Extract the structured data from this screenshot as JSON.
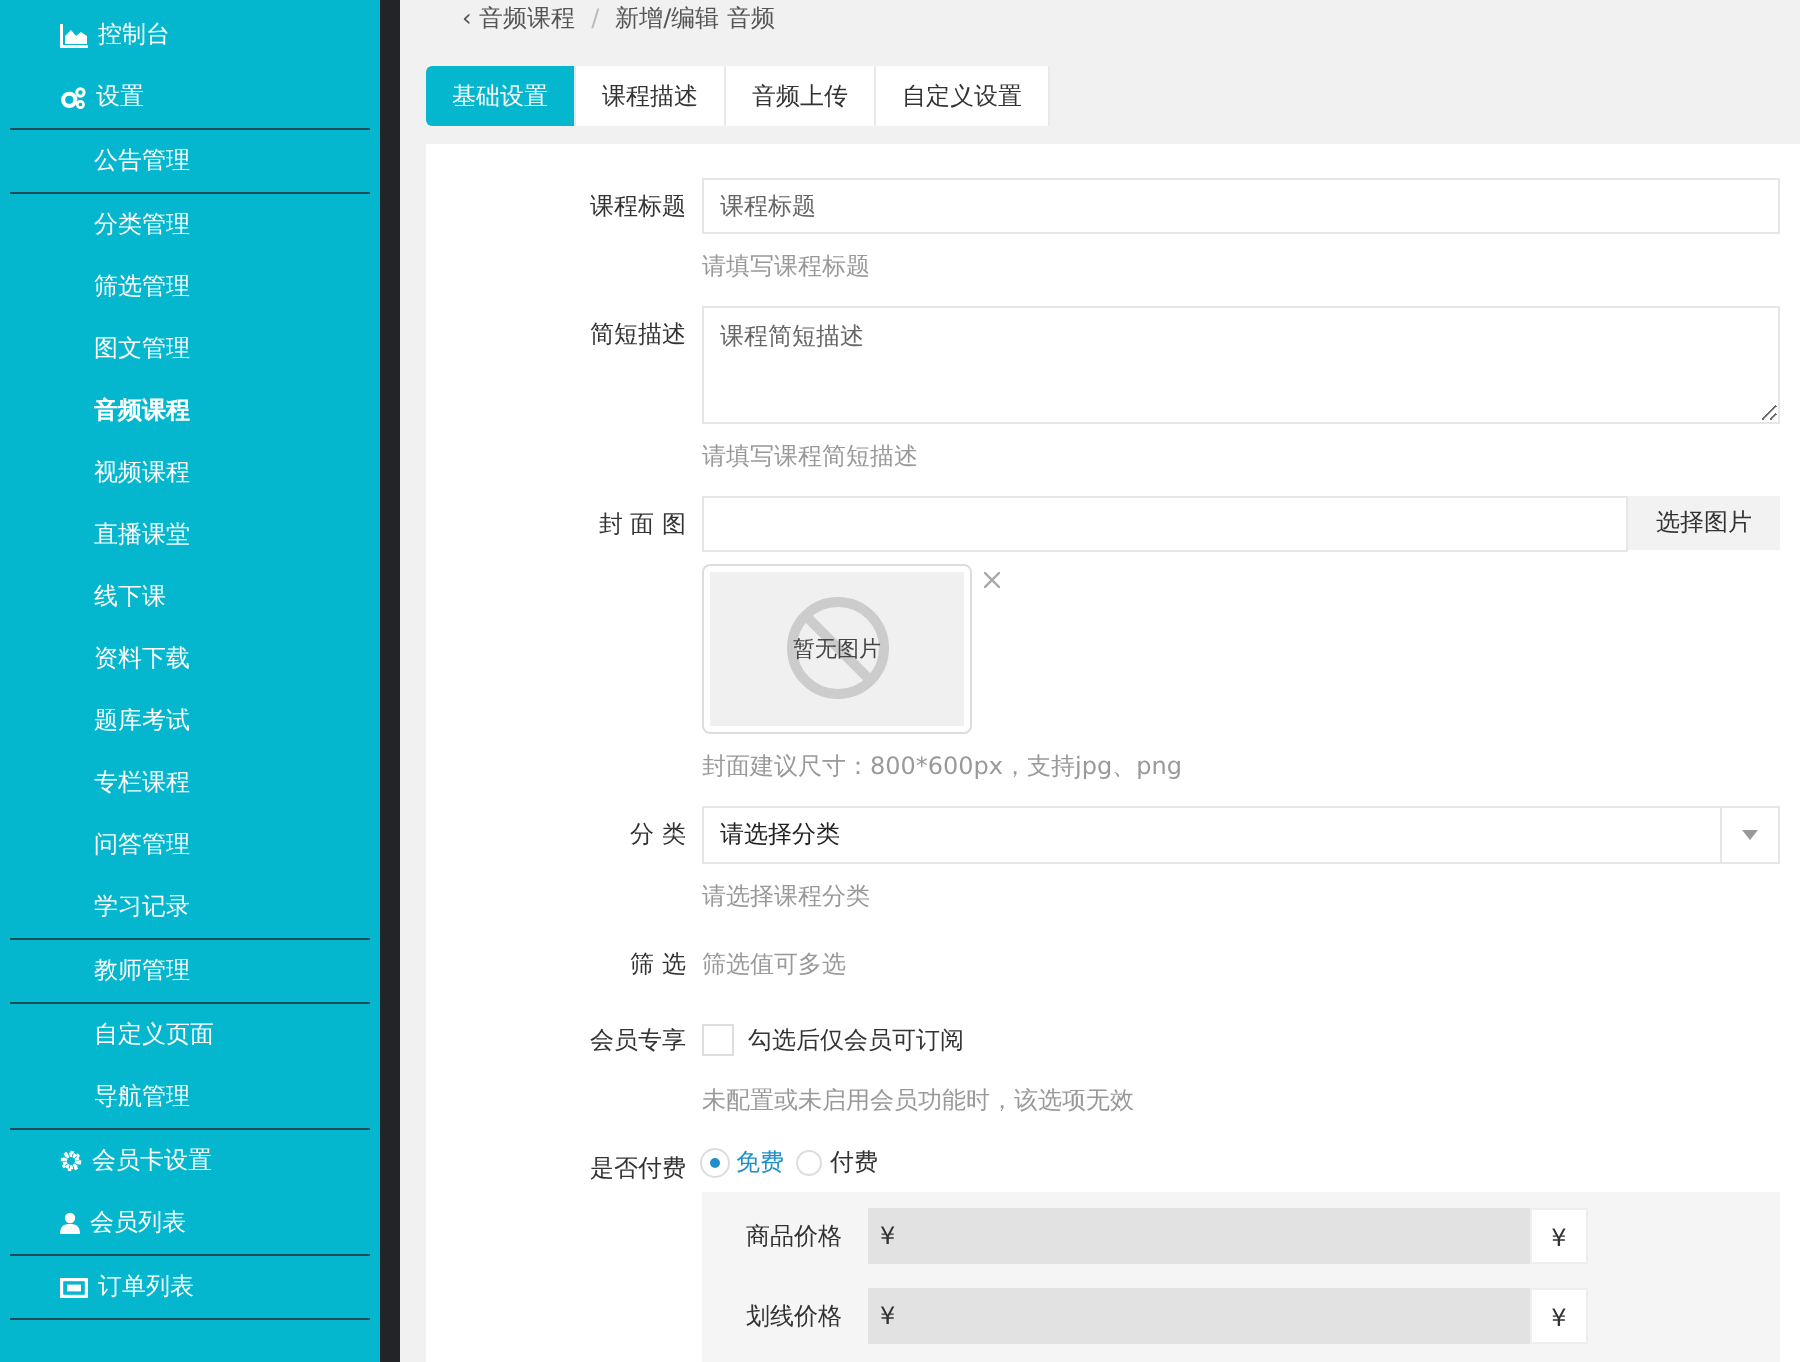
{
  "breadcrumb": {
    "back_icon": "‹",
    "back": "音频课程",
    "separator": "/",
    "current": "新增/编辑 音频"
  },
  "sidebar": {
    "groups": [
      {
        "items": [
          {
            "label": "控制台",
            "kind": "chart",
            "selected": false
          },
          {
            "label": "设置",
            "kind": "gears",
            "selected": false
          }
        ]
      },
      {
        "items": [
          {
            "label": "公告管理",
            "kind": "sub",
            "selected": false
          }
        ]
      },
      {
        "items": [
          {
            "label": "分类管理",
            "kind": "sub",
            "selected": false
          },
          {
            "label": "筛选管理",
            "kind": "sub",
            "selected": false
          },
          {
            "label": "图文管理",
            "kind": "sub",
            "selected": false
          },
          {
            "label": "音频课程",
            "kind": "sub",
            "selected": true
          },
          {
            "label": "视频课程",
            "kind": "sub",
            "selected": false
          },
          {
            "label": "直播课堂",
            "kind": "sub",
            "selected": false
          },
          {
            "label": "线下课",
            "kind": "sub",
            "selected": false
          },
          {
            "label": "资料下载",
            "kind": "sub",
            "selected": false
          },
          {
            "label": "题库考试",
            "kind": "sub",
            "selected": false
          },
          {
            "label": "专栏课程",
            "kind": "sub",
            "selected": false
          },
          {
            "label": "问答管理",
            "kind": "sub",
            "selected": false
          },
          {
            "label": "学习记录",
            "kind": "sub",
            "selected": false
          }
        ]
      },
      {
        "items": [
          {
            "label": "教师管理",
            "kind": "sub",
            "selected": false
          }
        ]
      },
      {
        "items": [
          {
            "label": "自定义页面",
            "kind": "sub",
            "selected": false
          },
          {
            "label": "导航管理",
            "kind": "sub",
            "selected": false
          }
        ]
      },
      {
        "items": [
          {
            "label": "会员卡设置",
            "kind": "gear",
            "selected": false
          },
          {
            "label": "会员列表",
            "kind": "user",
            "selected": false
          }
        ]
      },
      {
        "items": [
          {
            "label": "订单列表",
            "kind": "card",
            "selected": false
          }
        ]
      }
    ]
  },
  "tabs": [
    {
      "label": "基础设置",
      "selected": true
    },
    {
      "label": "课程描述",
      "selected": false
    },
    {
      "label": "音频上传",
      "selected": false
    },
    {
      "label": "自定义设置",
      "selected": false
    }
  ],
  "form": {
    "title": {
      "label": "课程标题",
      "placeholder": "课程标题",
      "hint": "请填写课程标题"
    },
    "summary": {
      "label": "简短描述",
      "placeholder": "课程简短描述",
      "hint": "请填写课程简短描述"
    },
    "cover": {
      "label": "封 面 图",
      "button": "选择图片",
      "image_text": "暂无图片",
      "hint": "封面建议尺寸：800*600px，支持jpg、png"
    },
    "category": {
      "label": "分 类",
      "value": "请选择分类",
      "hint": "请选择课程分类"
    },
    "filter": {
      "label": "筛 选",
      "hint": "筛选值可多选"
    },
    "members_only": {
      "label": "会员专享",
      "checked": false,
      "text": "勾选后仅会员可订阅",
      "hint": "未配置或未启用会员功能时，该选项无效"
    },
    "paid": {
      "label": "是否付费",
      "options": [
        {
          "label": "免费",
          "selected": true
        },
        {
          "label": "付费",
          "selected": false
        }
      ]
    },
    "prices": [
      {
        "label": "商品价格",
        "prefix": "¥",
        "suffix": "¥"
      },
      {
        "label": "划线价格",
        "prefix": "¥",
        "suffix": "¥"
      }
    ]
  }
}
